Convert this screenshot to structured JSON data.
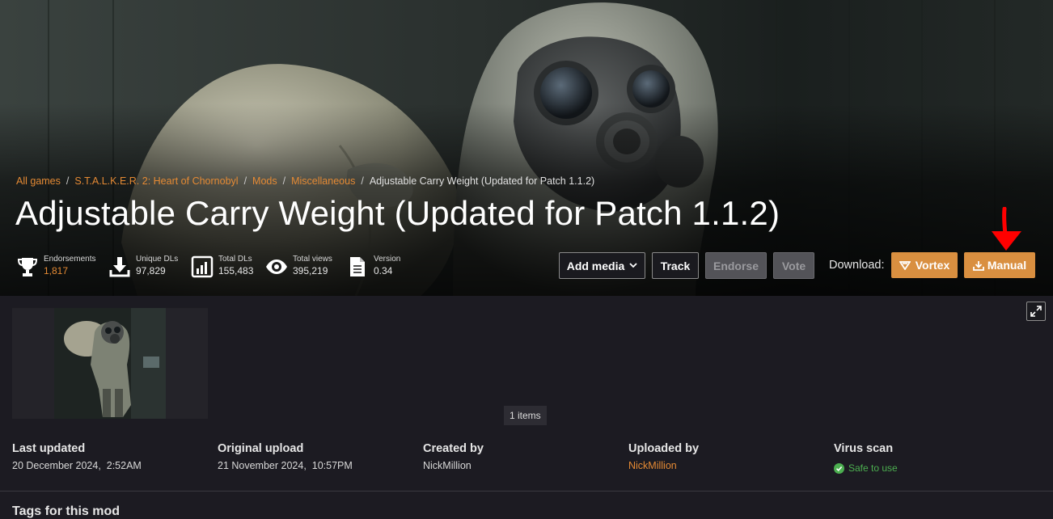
{
  "breadcrumb": {
    "all_games": "All games",
    "game": "S.T.A.L.K.E.R. 2: Heart of Chornobyl",
    "mods": "Mods",
    "category": "Miscellaneous",
    "current": "Adjustable Carry Weight (Updated for Patch 1.1.2)",
    "separator": "/"
  },
  "title": "Adjustable Carry Weight (Updated for Patch 1.1.2)",
  "stats": {
    "endorsements": {
      "label": "Endorsements",
      "value": "1,817",
      "icon": "trophy-icon"
    },
    "unique_dls": {
      "label": "Unique DLs",
      "value": "97,829",
      "icon": "download-icon"
    },
    "total_dls": {
      "label": "Total DLs",
      "value": "155,483",
      "icon": "bar-chart-icon"
    },
    "total_views": {
      "label": "Total views",
      "value": "395,219",
      "icon": "eye-icon"
    },
    "version": {
      "label": "Version",
      "value": "0.34",
      "icon": "document-icon"
    }
  },
  "actions": {
    "add_media": "Add media",
    "track": "Track",
    "endorse": "Endorse",
    "vote": "Vote",
    "download_label": "Download:",
    "vortex": "Vortex",
    "manual": "Manual"
  },
  "gallery": {
    "items_count": "1 items"
  },
  "meta": {
    "last_updated": {
      "label": "Last updated",
      "date": "20 December 2024,",
      "time": "2:52AM"
    },
    "original_upload": {
      "label": "Original upload",
      "date": "21 November 2024,",
      "time": "10:57PM"
    },
    "created_by": {
      "label": "Created by",
      "value": "NickMillion"
    },
    "uploaded_by": {
      "label": "Uploaded by",
      "value": "NickMillion"
    },
    "virus_scan": {
      "label": "Virus scan",
      "value": "Safe to use"
    }
  },
  "next_section_heading": "Tags for this mod",
  "colors": {
    "accent_orange": "#d98f40",
    "link_orange": "#e58a34",
    "safe_green": "#4caf50",
    "annotation_red": "#ff0000",
    "page_bg": "#1c1b22"
  }
}
